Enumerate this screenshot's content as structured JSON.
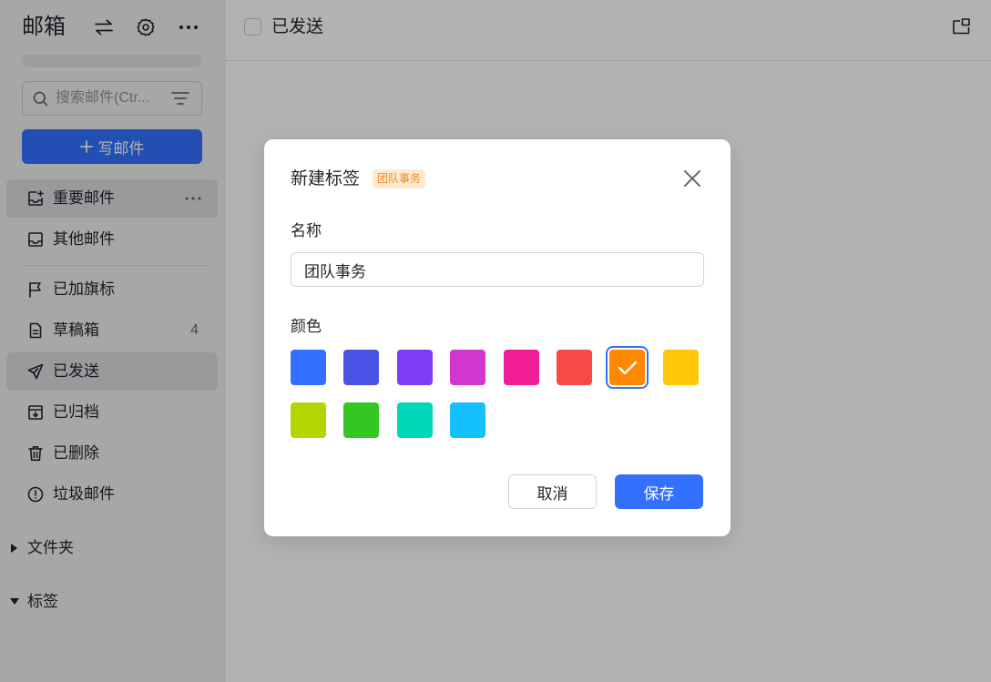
{
  "app": {
    "title": "邮箱",
    "accent_color": "#3370ff"
  },
  "toolbar": {
    "icons": [
      "swap-icon",
      "gear-icon",
      "more-icon"
    ]
  },
  "sidebar": {
    "search_placeholder": "搜索邮件(Ctr...",
    "compose_label": "写邮件",
    "nav": [
      {
        "label": "重要邮件",
        "icon": "inbox-star-icon",
        "hovered": true
      },
      {
        "label": "其他邮件",
        "icon": "inbox-icon"
      },
      {
        "label": "已加旗标",
        "icon": "flag-icon"
      },
      {
        "label": "草稿箱",
        "icon": "draft-icon",
        "count": "4"
      },
      {
        "label": "已发送",
        "icon": "send-icon",
        "selected": true
      },
      {
        "label": "已归档",
        "icon": "archive-icon"
      },
      {
        "label": "已删除",
        "icon": "trash-icon"
      },
      {
        "label": "垃圾邮件",
        "icon": "spam-icon"
      }
    ],
    "sections": [
      {
        "label": "文件夹",
        "expanded": false
      },
      {
        "label": "标签",
        "expanded": true
      }
    ]
  },
  "main": {
    "title": "已发送"
  },
  "modal": {
    "title": "新建标签",
    "preview_badge": "团队事务",
    "preview_badge_bg": "#feead2",
    "preview_badge_color": "#f08a24",
    "name_label": "名称",
    "name_value": "团队事务",
    "color_label": "颜色",
    "colors": [
      "#3370ff",
      "#4954e6",
      "#7f3bf5",
      "#d136d1",
      "#f01d94",
      "#f54a45",
      "#ff8800",
      "#ffc60a",
      "#b3d600",
      "#34c724",
      "#00d6b9",
      "#14c0ff"
    ],
    "selected_color_index": 6,
    "cancel_label": "取消",
    "save_label": "保存"
  }
}
